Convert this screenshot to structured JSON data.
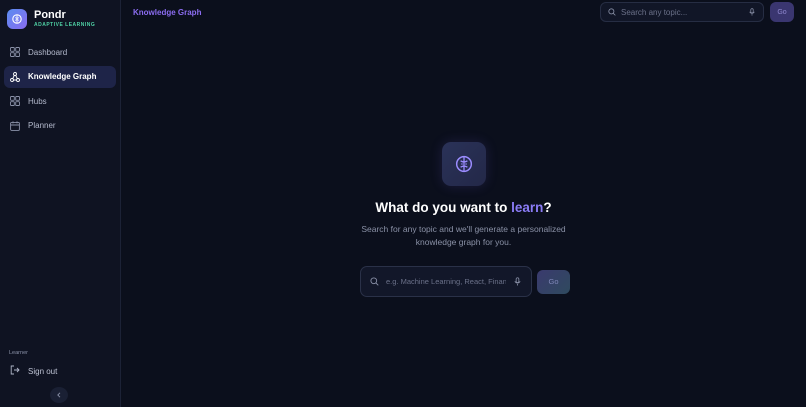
{
  "brand": {
    "name": "Pondr",
    "tagline": "ADAPTIVE LEARNING"
  },
  "sidebar": {
    "items": [
      {
        "label": "Dashboard",
        "icon": "grid-icon",
        "active": false
      },
      {
        "label": "Knowledge Graph",
        "icon": "graph-icon",
        "active": true
      },
      {
        "label": "Hubs",
        "icon": "hubs-icon",
        "active": false
      },
      {
        "label": "Planner",
        "icon": "calendar-icon",
        "active": false
      }
    ],
    "user_label": "Learner",
    "signout_label": "Sign out"
  },
  "header": {
    "title": "Knowledge Graph",
    "search_placeholder": "Search any topic...",
    "go_label": "Go"
  },
  "hero": {
    "title_prefix": "What do you want to ",
    "title_accent": "learn",
    "title_suffix": "?",
    "subtitle": "Search for any topic and we'll generate a personalized knowledge graph for you.",
    "search_placeholder": "e.g. Machine Learning, React, Finance...",
    "go_label": "Go"
  },
  "colors": {
    "accent": "#8b7cf6",
    "brand_tag": "#4fd1a5",
    "background": "#0b0f1c"
  }
}
